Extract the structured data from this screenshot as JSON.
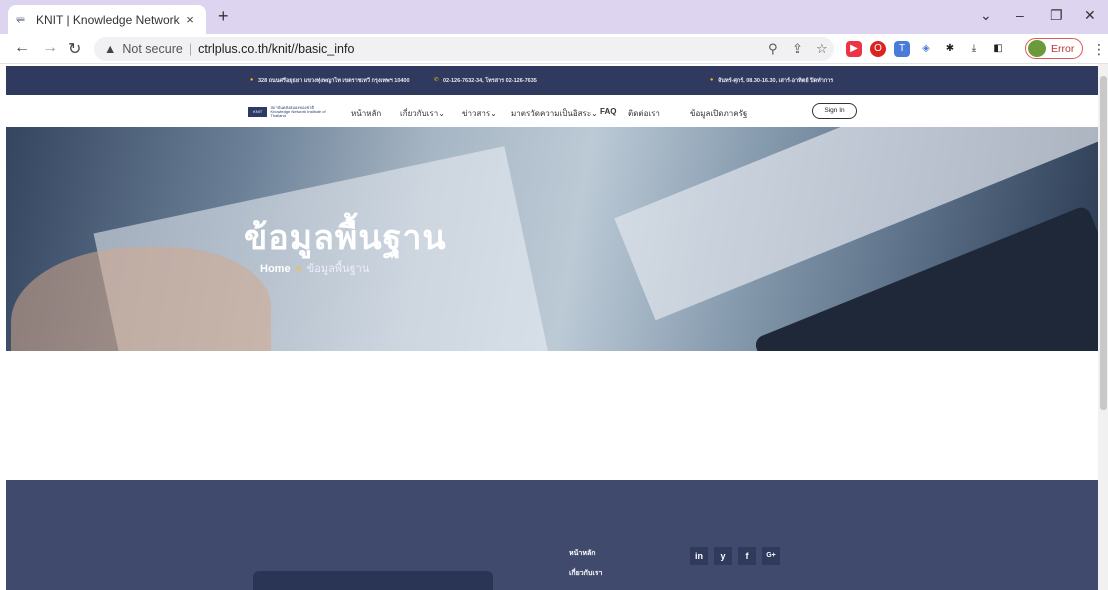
{
  "browser": {
    "tab_title": "KNIT | Knowledge Network Instit",
    "tab_close": "×",
    "new_tab": "+",
    "not_secure": "Not secure",
    "url": "ctrlplus.co.th/knit//basic_info",
    "profile_label": "Error"
  },
  "site": {
    "topbar": {
      "address": "328 ถนนศรีอยุธยา แขวงทุ่งพญาไท เขตราชเทวี กรุงเทพฯ 10400",
      "phone": "02-126-7632-34, โทรสาร 02-126-7635",
      "hours": "จันทร์-ศุกร์, 08.30-16.30, เสาร์-อาทิตย์ ปิดทำการ"
    },
    "logo": {
      "mark": "KNIT",
      "line1": "สถาบันคลังสมองของชาติ",
      "line2": "Knowledge Network Institute of Thailand"
    },
    "nav": {
      "home": "หน้าหลัก",
      "about": "เกี่ยวกับเรา",
      "news": "ข่าวสาร",
      "ita": "มาตรวัดความเป็นอิสระ",
      "faq": "FAQ",
      "contact": "ติดต่อเรา",
      "opendata": "ข้อมูลเปิดภาครัฐ",
      "signin": "Sign In"
    },
    "hero": {
      "title": "ข้อมูลพื้นฐาน",
      "crumb_home": "Home",
      "crumb_sep": "»",
      "crumb_current": "ข้อมูลพื้นฐาน"
    },
    "footer": {
      "link_home": "หน้าหลัก",
      "link_about": "เกี่ยวกับเรา",
      "social": [
        "in",
        "y",
        "f",
        "G+"
      ]
    }
  }
}
